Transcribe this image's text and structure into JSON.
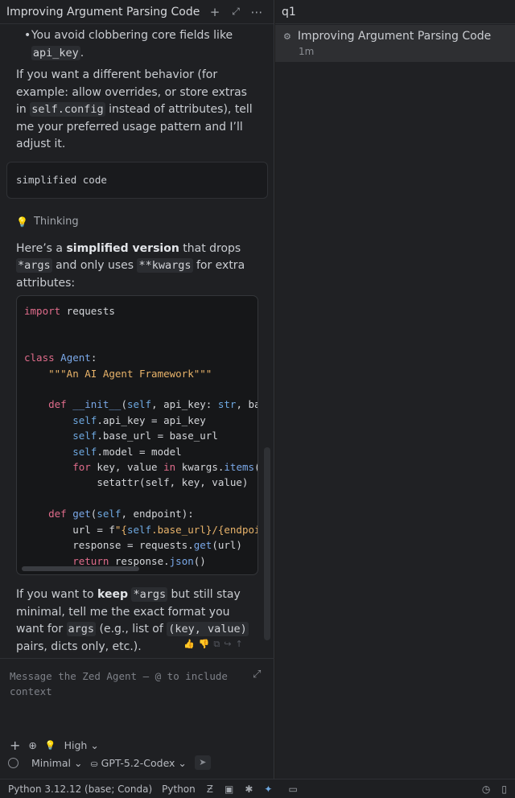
{
  "agent_panel": {
    "title": "Improving Argument Parsing Code",
    "icons": {
      "new": "plus-icon",
      "expand": "expand-icon",
      "more": "more-icon"
    }
  },
  "conversation": {
    "bullet_prefix": "You avoid clobbering core fields like",
    "bullet_code": "api_key",
    "bullet_suffix": ".",
    "para1_a": "If you want a different behavior (for example: allow overrides, or store extras in",
    "para1_code": "self.config",
    "para1_b": "instead of attributes), tell me your preferred usage pattern and I’ll adjust it.",
    "user_message": "simplified code",
    "thinking_label": "Thinking",
    "para2_a": "Here’s a ",
    "para2_bold": "simplified version",
    "para2_b": " that drops ",
    "para2_code1": "*args",
    "para2_c": " and only uses ",
    "para2_code2": "**kwargs",
    "para2_d": " for extra attributes:",
    "para3_a": "If you want to ",
    "para3_bold": "keep",
    "para3_code1": "*args",
    "para3_b": " but still stay minimal, tell me the exact format you want for ",
    "para3_code2": "args",
    "para3_c": " (e.g., list of ",
    "para3_code3": "(key, value)",
    "para3_d": " pairs, dicts only, etc.)."
  },
  "code": {
    "l1_kw": "import",
    "l1_rest": " requests",
    "l2_kw": "class",
    "l2_name": "Agent",
    "l2_rest": ":",
    "l3_str": "\"\"\"An AI Agent Framework\"\"\"",
    "l4_kw": "def",
    "l4_name": "__init__",
    "l4_rest_a": "(",
    "l4_self": "self",
    "l4_rest_b": ", api_key: ",
    "l4_type": "str",
    "l4_rest_c": ", bas",
    "l5_self": "self",
    "l5_rest": ".api_key = api_key",
    "l6_self": "self",
    "l6_rest": ".base_url = base_url",
    "l7_self": "self",
    "l7_rest": ".model = model",
    "l8_kw1": "for",
    "l8_rest_a": " key, value ",
    "l8_kw2": "in",
    "l8_rest_b": " kwargs.",
    "l8_fn": "items",
    "l8_rest_c": "()",
    "l9_rest_a": "setattr(self, key, value)",
    "l10_kw": "def",
    "l10_name": "get",
    "l10_rest_a": "(",
    "l10_self": "self",
    "l10_rest_b": ", endpoint):",
    "l11_rest_a": "url = f",
    "l11_str_a": "\"{",
    "l11_self": "self",
    "l11_str_b": ".base_url}/{endpoi",
    "l12_rest_a": "response = requests.",
    "l12_fn": "get",
    "l12_rest_b": "(url)",
    "l13_kw": "return",
    "l13_rest_a": " response.",
    "l13_fn": "json",
    "l13_rest_b": "()"
  },
  "composer": {
    "placeholder": "Message the Zed Agent — @ to include context",
    "thinking_level": "High",
    "mode": "Minimal",
    "model": "GPT-5.2-Codex"
  },
  "threads": {
    "header": "q1",
    "items": [
      {
        "title": "Improving Argument Parsing Code",
        "time": "1m"
      }
    ]
  },
  "statusbar": {
    "interpreter": "Python 3.12.12 (base; Conda)",
    "language": "Python"
  }
}
